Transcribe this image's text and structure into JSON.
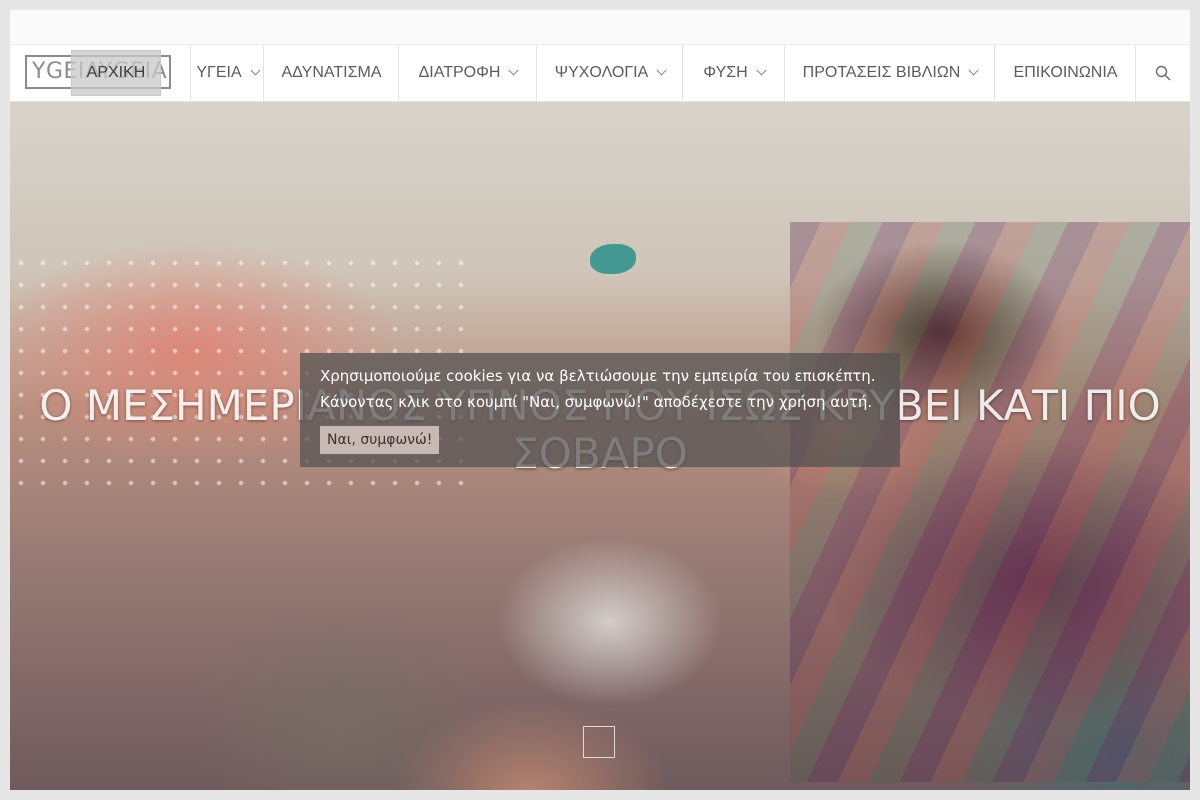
{
  "logo": {
    "text": "YGEIAYGEIA"
  },
  "nav": {
    "active": "ΑΡΧΙΚΗ",
    "items": [
      {
        "label": "ΥΓΕΙΑ",
        "dropdown": true
      },
      {
        "label": "ΑΔΥΝΑΤΙΣΜΑ",
        "dropdown": false
      },
      {
        "label": "ΔΙΑΤΡΟΦΗ",
        "dropdown": true
      },
      {
        "label": "ΨΥΧΟΛΟΓΙΑ",
        "dropdown": true
      },
      {
        "label": "ΦΥΣΗ",
        "dropdown": true
      },
      {
        "label": "ΠΡΟΤΑΣΕΙΣ ΒΙΒΛΙΩΝ",
        "dropdown": true
      },
      {
        "label": "ΕΠΙΚΟΙΝΩΝΙΑ",
        "dropdown": false
      }
    ],
    "search_icon": "search-icon"
  },
  "hero": {
    "title_line1": "Ο ΜΕΣΗΜΕΡΙΑΝΟΣ ΥΠΝΟΣ ΠΟΥ ΙΣΩΣ ΚΡΥΒΕΙ ΚΑΤΙ ΠΙΟ",
    "title_line2": "ΣΟΒΑΡΟ"
  },
  "cookie": {
    "line1": "Χρησιμοποιούμε cookies για να βελτιώσουμε την εμπειρία του επισκέπτη.",
    "line2": "Κάνοντας κλικ στο κουμπί \"Ναι, συμφωνώ!\" αποδέχεστε την χρήση αυτή.",
    "button": "Ναι, συμφωνώ!"
  },
  "colors": {
    "nav_text": "#5c5c5c",
    "cookie_bg": "#505050",
    "cookie_button": "#c7b9b4"
  }
}
